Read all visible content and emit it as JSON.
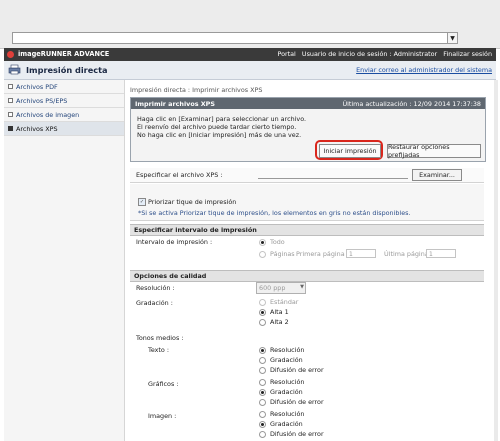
{
  "app": {
    "brand": "imageRUNNER ADVANCE",
    "header_links": [
      "Portal",
      "Usuario de inicio de sesión : Administrator",
      "Finalizar sesión"
    ],
    "page_title": "Impresión directa",
    "email_link": "Enviar correo al administrador del sistema"
  },
  "sidebar": {
    "items": [
      {
        "label": "Archivos PDF",
        "active": false
      },
      {
        "label": "Archivos PS/EPS",
        "active": false
      },
      {
        "label": "Archivos de imagen",
        "active": false
      },
      {
        "label": "Archivos XPS",
        "active": true
      }
    ]
  },
  "breadcrumb": "Impresión directa : Imprimir archivos XPS",
  "notice": {
    "title": "Imprimir archivos XPS",
    "update": "Última actualización : 12/09 2014 17:37:38",
    "lines": [
      "Haga clic en [Examinar] para seleccionar un archivo.",
      "El reenvío del archivo puede tardar cierto tiempo.",
      "No haga clic en [Iniciar impresión] más de una vez."
    ],
    "start_button": "Iniciar impresión",
    "reset_button": "Restaurar opciones prefijadas"
  },
  "file": {
    "label": "Especificar el archivo XPS :",
    "browse_button": "Examinar..."
  },
  "priority": {
    "checkbox_label": "Priorizar tique de impresión",
    "checked": true,
    "note": "*Si se activa Priorizar tique de impresión, los elementos en gris no están disponibles."
  },
  "print_range": {
    "section_title": "Especificar intervalo de impresión",
    "label": "Intervalo de impresión :",
    "option_all": "Todo",
    "option_pages": "Páginas",
    "first_page_label": "Primera página :",
    "first_page_value": "1",
    "last_page_label": "Última página :",
    "last_page_value": "1"
  },
  "quality": {
    "section_title": "Opciones de calidad",
    "resolution_label": "Resolución :",
    "resolution_value": "600 ppp",
    "gradation_label": "Gradación :",
    "gradation_options": [
      "Estándar",
      "Alta 1",
      "Alta 2"
    ],
    "gradation_selected": "Alta 1",
    "halftones_label": "Tonos medios :",
    "groups": [
      {
        "label": "Texto :",
        "options": [
          "Resolución",
          "Gradación",
          "Difusión de error"
        ],
        "selected": "Resolución"
      },
      {
        "label": "Gráficos :",
        "options": [
          "Resolución",
          "Gradación",
          "Difusión de error"
        ],
        "selected": "Gradación"
      },
      {
        "label": "Imagen :",
        "options": [
          "Resolución",
          "Gradación",
          "Difusión de error"
        ],
        "selected": "Gradación"
      }
    ]
  }
}
